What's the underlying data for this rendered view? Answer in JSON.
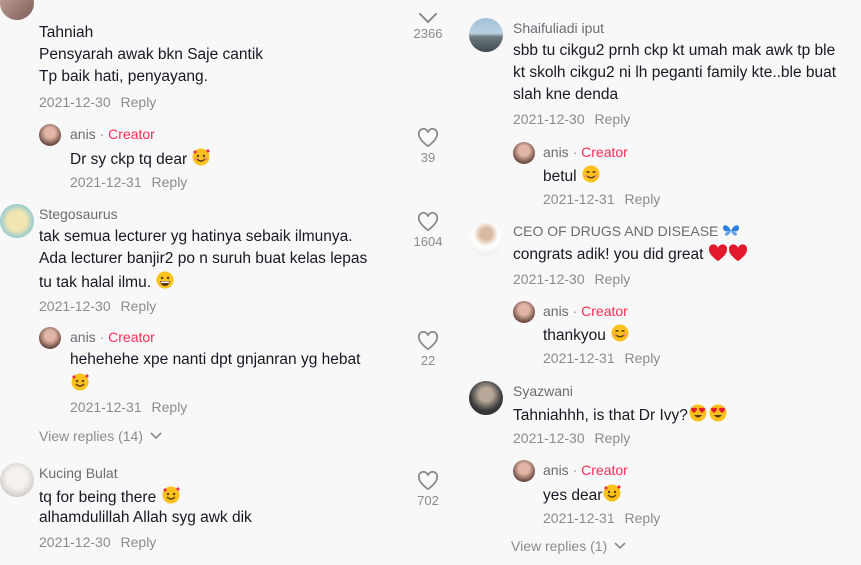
{
  "left": {
    "top_counter": "2366",
    "c1": {
      "username": "Tahniah",
      "line1": "Pensyarah awak bkn Saje cantik",
      "line2": "Tp baik hati, penyayang.",
      "date": "2021-12-30",
      "reply": "Reply"
    },
    "r1": {
      "username": "anis",
      "dot": "·",
      "creator": "Creator",
      "text": "Dr sy ckp tq dear",
      "date": "2021-12-31",
      "reply": "Reply",
      "likes": "39"
    },
    "c2": {
      "username": "Stegosaurus",
      "line1": "tak semua lecturer yg hatinya sebaik ilmunya.",
      "line2": "Ada lecturer banjir2 po n suruh buat kelas lepas",
      "line3": "tu tak halal ilmu.",
      "date": "2021-12-30",
      "reply": "Reply",
      "likes": "1604"
    },
    "r2": {
      "username": "anis",
      "dot": "·",
      "creator": "Creator",
      "text": "hehehehe xpe nanti dpt gnjanran yg hebat",
      "date": "2021-12-31",
      "reply": "Reply",
      "likes": "22"
    },
    "view_replies": "View replies (14)",
    "c3": {
      "username": "Kucing Bulat",
      "line1": "tq for being there",
      "line2": "alhamdulillah Allah syg awk dik",
      "date": "2021-12-30",
      "reply": "Reply",
      "likes": "702"
    }
  },
  "right": {
    "c1": {
      "username": "Shaifuliadi iput",
      "line1": "sbb tu cikgu2 prnh ckp kt umah mak awk tp ble",
      "line2": "kt skolh cikgu2 ni lh peganti family kte..ble buat",
      "line3": "slah kne denda",
      "date": "2021-12-30",
      "reply": "Reply"
    },
    "r1": {
      "username": "anis",
      "dot": "·",
      "creator": "Creator",
      "text": "betul",
      "date": "2021-12-31",
      "reply": "Reply"
    },
    "c2": {
      "username": "CEO OF DRUGS AND DISEASE",
      "text": "congrats adik! you did great",
      "date": "2021-12-30",
      "reply": "Reply"
    },
    "r2": {
      "username": "anis",
      "dot": "·",
      "creator": "Creator",
      "text": "thankyou",
      "date": "2021-12-31",
      "reply": "Reply"
    },
    "c3": {
      "username": "Syazwani",
      "text": "Tahniahhh, is that Dr Ivy?",
      "date": "2021-12-30",
      "reply": "Reply"
    },
    "r3": {
      "username": "anis",
      "dot": "·",
      "creator": "Creator",
      "text": "yes dear",
      "date": "2021-12-31",
      "reply": "Reply"
    },
    "view_replies": "View replies (1)"
  },
  "colors": {
    "creator": "#fe2c55",
    "muted": "#8a8b91",
    "text": "#161823",
    "background": "#f8f8f8"
  },
  "icons": [
    "heart-outline-icon",
    "chevron-down-icon",
    "smiling-face-with-hearts-emoji",
    "smiling-face-emoji",
    "grinning-face-emoji",
    "red-heart-emoji",
    "heart-eyes-emoji",
    "blue-butterfly-emoji"
  ]
}
